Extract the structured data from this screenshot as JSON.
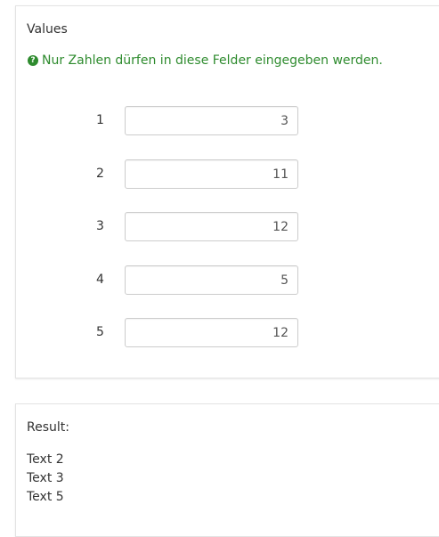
{
  "values_panel": {
    "title": "Values",
    "hint": "Nur Zahlen dürfen in diese Felder eingegeben werden.",
    "hint_icon": "question-circle-icon",
    "rows": [
      {
        "label": "1",
        "value": "3"
      },
      {
        "label": "2",
        "value": "11"
      },
      {
        "label": "3",
        "value": "12"
      },
      {
        "label": "4",
        "value": "5"
      },
      {
        "label": "5",
        "value": "12"
      }
    ]
  },
  "result_panel": {
    "title": "Result:",
    "items": [
      "Text 2",
      "Text 3",
      "Text 5"
    ]
  },
  "colors": {
    "hint": "#2e8b2e",
    "border": "#cccccc"
  }
}
